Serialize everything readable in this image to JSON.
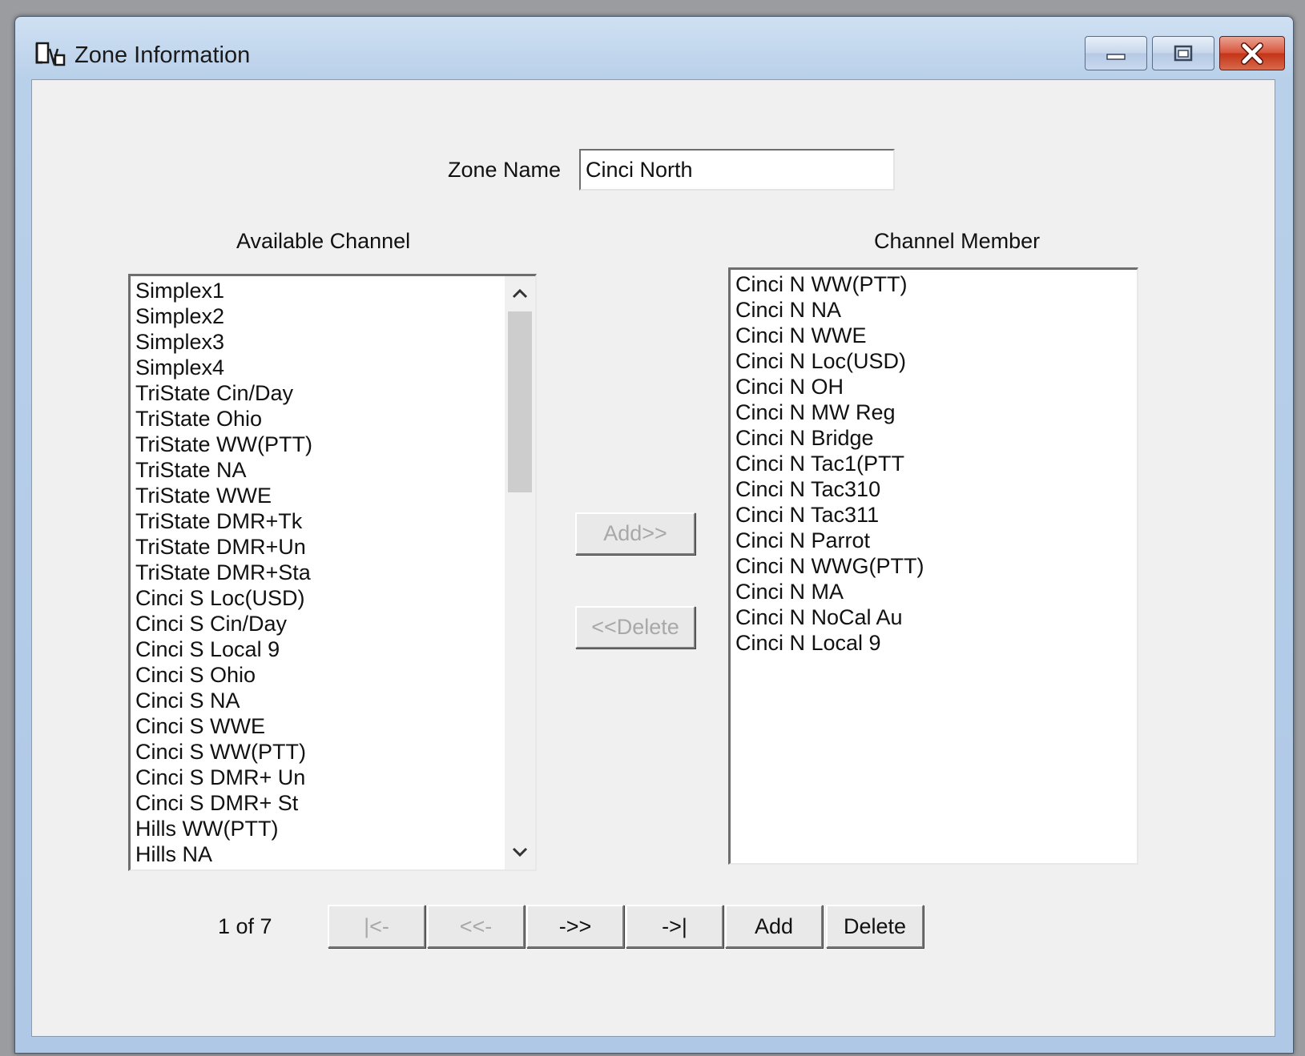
{
  "window": {
    "title": "Zone Information",
    "title_icon": "zone-app-icon",
    "caption_buttons": [
      "minimize",
      "maximize",
      "close"
    ]
  },
  "zone_name": {
    "label": "Zone Name",
    "value": "Cinci North"
  },
  "available_channel": {
    "label": "Available Channel",
    "items": [
      "Simplex1",
      "Simplex2",
      "Simplex3",
      "Simplex4",
      "TriState Cin/Day",
      "TriState Ohio",
      "TriState WW(PTT)",
      "TriState NA",
      "TriState WWE",
      "TriState DMR+Tk",
      "TriState DMR+Un",
      "TriState DMR+Sta",
      "Cinci S Loc(USD)",
      "Cinci S Cin/Day",
      "Cinci S Local 9",
      "Cinci S Ohio",
      "Cinci S NA",
      "Cinci S WWE",
      "Cinci S WW(PTT)",
      "Cinci S DMR+ Un",
      "Cinci S DMR+ St",
      "Hills WW(PTT)",
      "Hills NA"
    ]
  },
  "channel_member": {
    "label": "Channel Member",
    "items": [
      "Cinci N WW(PTT)",
      "Cinci N NA",
      "Cinci N WWE",
      "Cinci N Loc(USD)",
      "Cinci N OH",
      "Cinci N MW Reg",
      "Cinci N Bridge",
      "Cinci N Tac1(PTT",
      "Cinci N Tac310",
      "Cinci N Tac311",
      "Cinci N Parrot",
      "Cinci N WWG(PTT)",
      "Cinci N MA",
      "Cinci N NoCal Au",
      "Cinci N Local 9"
    ]
  },
  "transfer": {
    "add_label": "Add>>",
    "delete_label": "<<Delete"
  },
  "pager": {
    "status": "1 of 7",
    "first_label": "|<-",
    "prev_label": "<<-",
    "next_label": "->>",
    "last_label": "->|",
    "add_label": "Add",
    "delete_label": "Delete"
  }
}
